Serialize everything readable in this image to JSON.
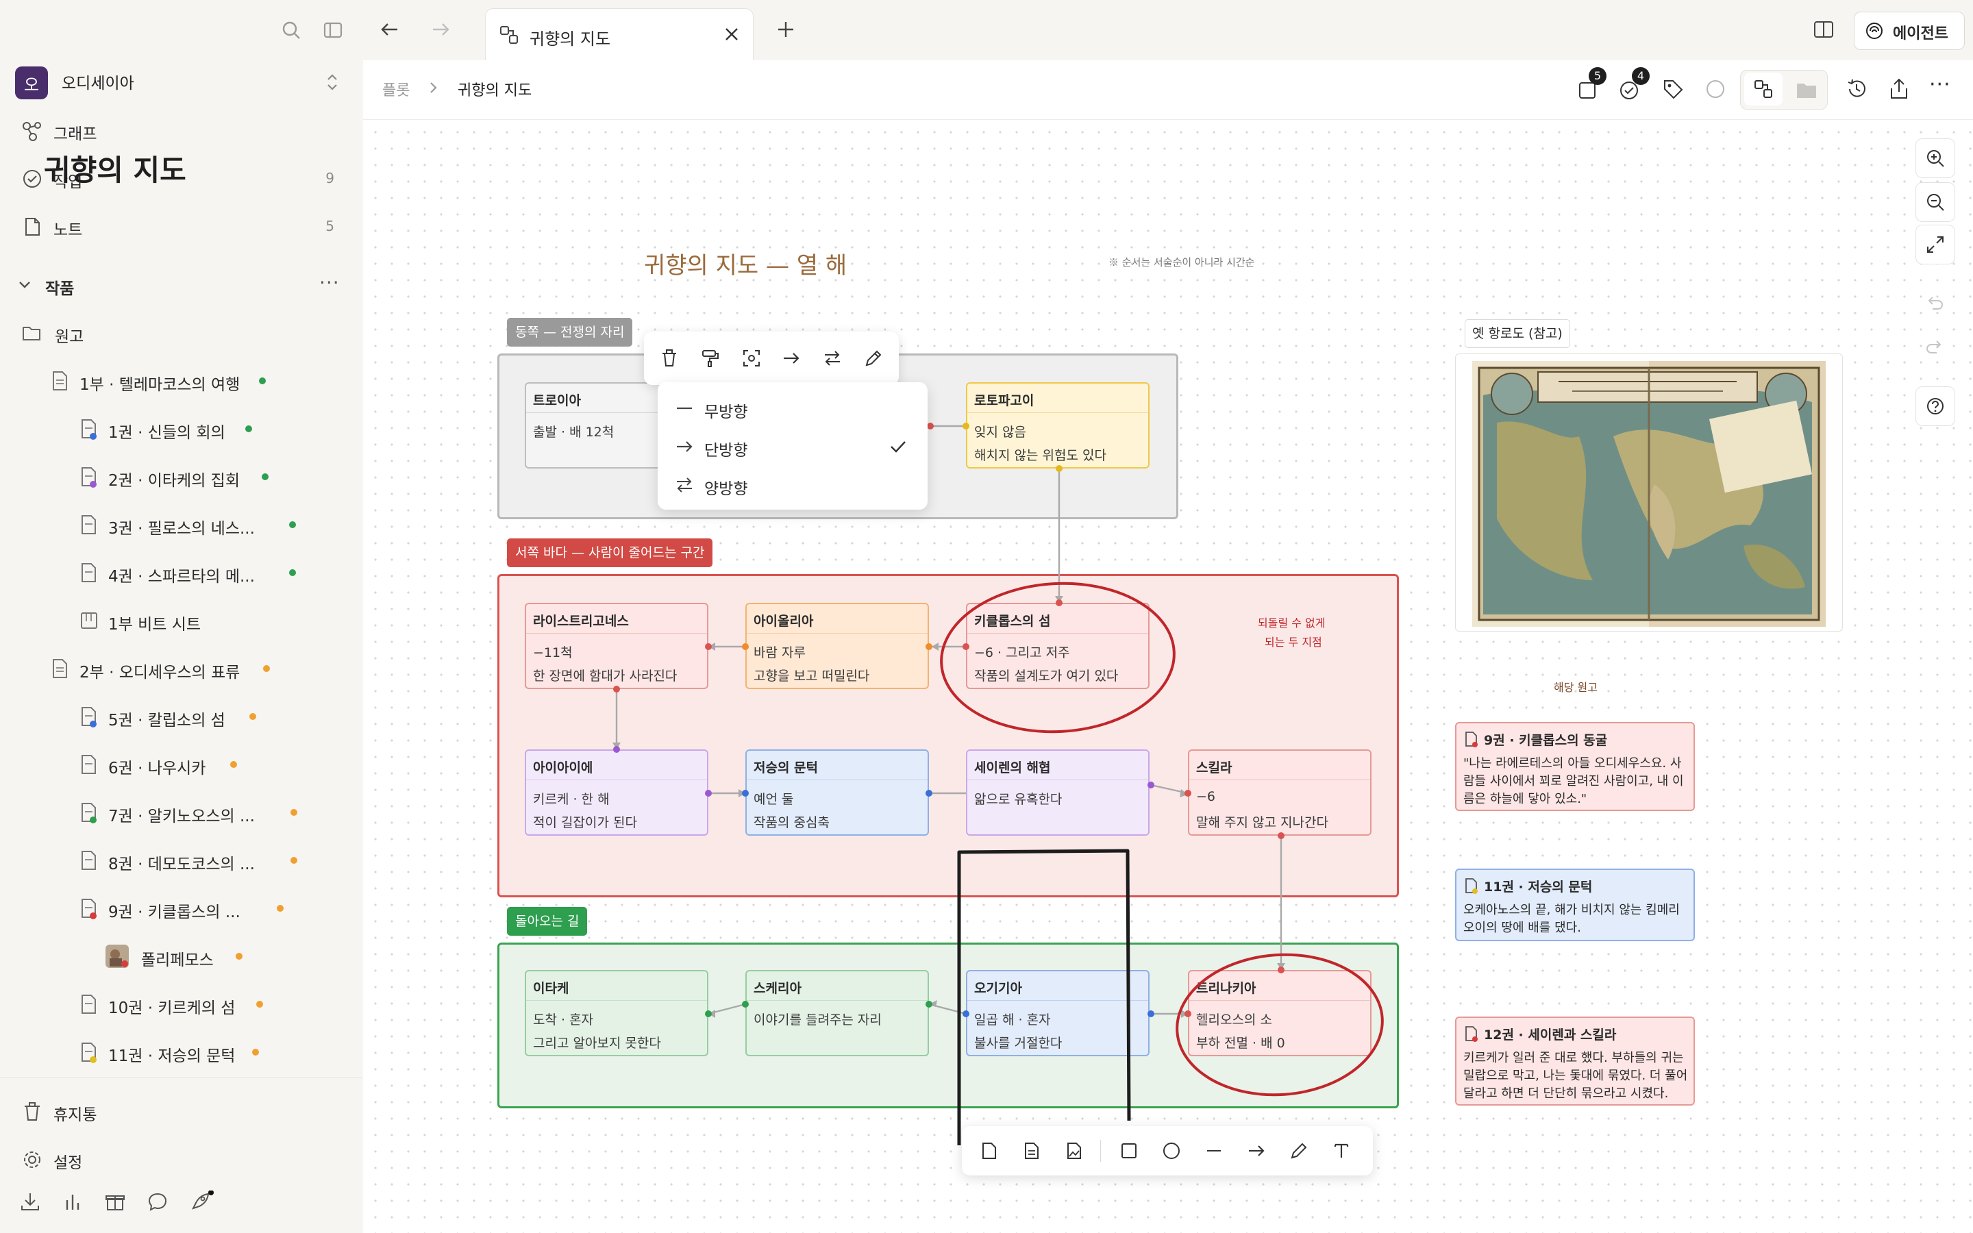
{
  "sidebar": {
    "workspace_initial": "오",
    "workspace_name": "오디세이아",
    "nav": [
      {
        "label": "그래프",
        "count": ""
      },
      {
        "label": "작업",
        "count": "9"
      },
      {
        "label": "노트",
        "count": "5"
      }
    ],
    "section_title": "작품",
    "tree": [
      {
        "label": "원고"
      },
      {
        "label": "1부 · 텔레마코스의 여행",
        "status": "#2e9e4f"
      },
      {
        "label": "1권 · 신들의 회의",
        "status": "#2e9e4f",
        "tag": "#3b6fd8"
      },
      {
        "label": "2권 · 이타케의 집회",
        "status": "#2e9e4f",
        "tag": "#9b59d0"
      },
      {
        "label": "3권 · 필로스의 네스...",
        "status": "#2e9e4f"
      },
      {
        "label": "4권 · 스파르타의 메...",
        "status": "#2e9e4f"
      },
      {
        "label": "1부 비트 시트"
      },
      {
        "label": "2부 · 오디세우스의 표류",
        "status": "#f0a030"
      },
      {
        "label": "5권 · 칼립소의 섬",
        "status": "#f0a030",
        "tag": "#3b6fd8"
      },
      {
        "label": "6권 · 나우시카",
        "status": "#f0a030"
      },
      {
        "label": "7권 · 알키노오스의 ...",
        "status": "#f0a030",
        "tag": "#2e9e4f"
      },
      {
        "label": "8권 · 데모도코스의 ...",
        "status": "#f0a030"
      },
      {
        "label": "9권 · 키클롭스의 ...",
        "status": "#f0a030",
        "tag": "#d93a3a"
      },
      {
        "label": "폴리페모스",
        "status": "#f0a030"
      },
      {
        "label": "10권 · 키르케의 섬",
        "status": "#f0a030"
      },
      {
        "label": "11권 · 저승의 문턱",
        "status": "#f0a030",
        "tag": "#e0c020"
      }
    ],
    "footer": [
      {
        "label": "휴지통"
      },
      {
        "label": "설정"
      }
    ]
  },
  "tabs": {
    "title": "귀향의 지도",
    "agent_label": "에이전트",
    "badge_a": "5",
    "badge_b": "4"
  },
  "breadcrumb": {
    "root": "플롯",
    "current": "귀향의 지도"
  },
  "canvas": {
    "title": "귀향의 지도",
    "handwritten_title": "귀향의 지도 — 열 해",
    "handwritten_note": "※ 순서는 서술순이 아니라 시간순",
    "circle_note_1": "되돌릴 수 없게",
    "circle_note_2": "되는 두 지점",
    "related_note": "해당 원고",
    "ref_label": "옛 항로도 (참고)",
    "groups": {
      "east": "동쪽 — 전쟁의 자리",
      "west": "서쪽 바다 — 사람이 줄어드는 구간",
      "home": "돌아오는 길"
    },
    "cards": {
      "troy": {
        "title": "트로이아",
        "l1": "출발 · 배 12척",
        "l2": ""
      },
      "lotus": {
        "title": "로토파고이",
        "l1": "잊지 않음",
        "l2": "해치지 않는 위험도 있다"
      },
      "laes": {
        "title": "라이스트리고네스",
        "l1": "−11척",
        "l2": "한 장면에 함대가 사라진다"
      },
      "aeolia": {
        "title": "아이올리아",
        "l1": "바람 자루",
        "l2": "고향을 보고 떠밀린다"
      },
      "cyclops": {
        "title": "키클롭스의 섬",
        "l1": "−6 · 그리고 저주",
        "l2": "작품의 설계도가 여기 있다"
      },
      "aiaia": {
        "title": "아이아이에",
        "l1": "키르케 · 한 해",
        "l2": "적이 길잡이가 된다"
      },
      "hades": {
        "title": "저승의 문턱",
        "l1": "예언 둘",
        "l2": "작품의 중심축"
      },
      "sirens": {
        "title": "세이렌의 해협",
        "l1": "앎으로 유혹한다",
        "l2": ""
      },
      "scylla": {
        "title": "스킬라",
        "l1": "−6",
        "l2": "말해 주지 않고 지나간다"
      },
      "ithaca": {
        "title": "이타케",
        "l1": "도착 · 혼자",
        "l2": "그리고 알아보지 못한다"
      },
      "scheria": {
        "title": "스케리아",
        "l1": "이야기를 들려주는 자리",
        "l2": ""
      },
      "ogygia": {
        "title": "오기기아",
        "l1": "일곱 해 · 혼자",
        "l2": "불사를 거절한다"
      },
      "thrinacia": {
        "title": "트리나키아",
        "l1": "헬리오스의 소",
        "l2": "부하 전멸 · 배 0"
      }
    },
    "notes": [
      {
        "title": "9권 · 키클롭스의 동굴",
        "body": "\"나는 라에르테스의 아들 오디세우스요. 사람들 사이에서 꾀로 알려진 사람이고, 내 이름은 하늘에 닿아 있소.\""
      },
      {
        "title": "11권 · 저승의 문턱",
        "body": "오케아노스의 끝, 해가 비치지 않는 킴메리오이의 땅에 배를 댔다."
      },
      {
        "title": "12권 · 세이렌과 스킬라",
        "body": "키르케가 일러 준 대로 했다. 부하들의 귀는 밀랍으로 막고, 나는 돛대에 묶였다. 더 풀어 달라고 하면 더 단단히 묶으라고 시켰다."
      }
    ]
  },
  "edge_menu": {
    "options": [
      "무방향",
      "단방향",
      "양방향"
    ],
    "selected": "단방향"
  },
  "colors": {
    "accent_purple": "#4a2e6b",
    "annotation_red": "#c0262a",
    "east_label_bg": "#9a9a9a",
    "west_label_bg": "#d24a45",
    "home_label_bg": "#2e9e4f"
  }
}
